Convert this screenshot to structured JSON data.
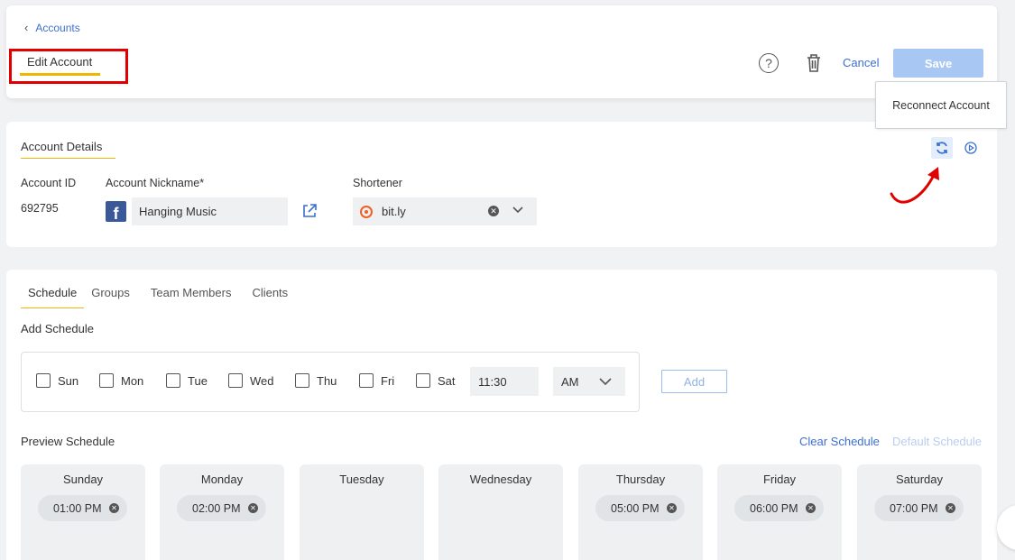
{
  "header": {
    "back_label": "Accounts",
    "title": "Edit Account",
    "help_icon": "question-circle-icon",
    "cancel_label": "Cancel",
    "save_label": "Save"
  },
  "tooltip": {
    "text": "Reconnect Account"
  },
  "details": {
    "section_title": "Account Details",
    "account_id_label": "Account ID",
    "account_id_value": "692795",
    "nickname_label": "Account Nickname*",
    "nickname_value": "Hanging Music",
    "network_icon": "facebook-icon",
    "shortener_label": "Shortener",
    "shortener_value": "bit.ly"
  },
  "schedule": {
    "tabs": [
      {
        "label": "Schedule",
        "active": true
      },
      {
        "label": "Groups",
        "active": false
      },
      {
        "label": "Team Members",
        "active": false
      },
      {
        "label": "Clients",
        "active": false
      }
    ],
    "add_schedule_label": "Add Schedule",
    "days": [
      "Sun",
      "Mon",
      "Tue",
      "Wed",
      "Thu",
      "Fri",
      "Sat"
    ],
    "time_value": "11:30",
    "ampm_value": "AM",
    "add_label": "Add",
    "preview_label": "Preview Schedule",
    "clear_schedule_label": "Clear Schedule",
    "default_schedule_label": "Default Schedule",
    "preview": [
      {
        "day": "Sunday",
        "times": [
          "01:00 PM"
        ]
      },
      {
        "day": "Monday",
        "times": [
          "02:00 PM"
        ]
      },
      {
        "day": "Tuesday",
        "times": []
      },
      {
        "day": "Wednesday",
        "times": []
      },
      {
        "day": "Thursday",
        "times": [
          "05:00 PM"
        ]
      },
      {
        "day": "Friday",
        "times": [
          "06:00 PM"
        ]
      },
      {
        "day": "Saturday",
        "times": [
          "07:00 PM"
        ]
      }
    ]
  },
  "colors": {
    "accent_blue": "#3b6fd1",
    "save_disabled": "#a8c7f2",
    "tab_underline": "#f2b500",
    "highlight_box": "#e00000",
    "annotation_arrow": "#e00000"
  }
}
